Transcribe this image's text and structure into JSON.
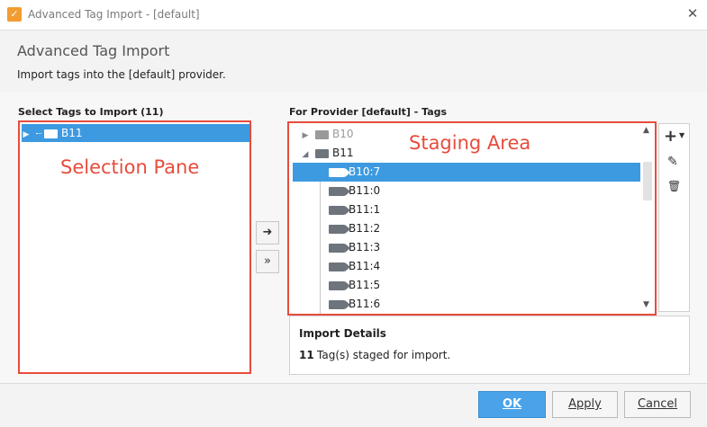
{
  "window": {
    "title": "Advanced Tag Import - [default]",
    "close_glyph": "✕",
    "app_glyph": "✓"
  },
  "header": {
    "title": "Advanced Tag Import",
    "subtitle": "Import tags into the [default] provider."
  },
  "left": {
    "label": "Select Tags to Import (11)",
    "tree": [
      {
        "label": "B11",
        "selected": true
      }
    ],
    "annotation": "Selection Pane"
  },
  "right": {
    "label": "For Provider [default] - Tags",
    "annotation": "Staging Area",
    "tree": [
      {
        "label": "B10",
        "type": "folder",
        "expanded": false,
        "disabled": true
      },
      {
        "label": "B11",
        "type": "folder",
        "expanded": true
      },
      {
        "label": "B10:7",
        "type": "tag",
        "selected": true
      },
      {
        "label": "B11:0",
        "type": "tag"
      },
      {
        "label": "B11:1",
        "type": "tag"
      },
      {
        "label": "B11:2",
        "type": "tag"
      },
      {
        "label": "B11:3",
        "type": "tag"
      },
      {
        "label": "B11:4",
        "type": "tag"
      },
      {
        "label": "B11:5",
        "type": "tag"
      },
      {
        "label": "B11:6",
        "type": "tag"
      }
    ]
  },
  "move_buttons": {
    "single": "➜",
    "all": "»"
  },
  "tools": {
    "add": "+",
    "edit": "✎",
    "delete": "🗑"
  },
  "details": {
    "title": "Import Details",
    "count": "11",
    "text": "Tag(s) staged for import."
  },
  "footer": {
    "ok": "OK",
    "apply": "Apply",
    "cancel": "Cancel"
  },
  "colors": {
    "selection": "#3e9ae0",
    "annotation": "#e74c3c",
    "primary": "#4aa3e8"
  }
}
